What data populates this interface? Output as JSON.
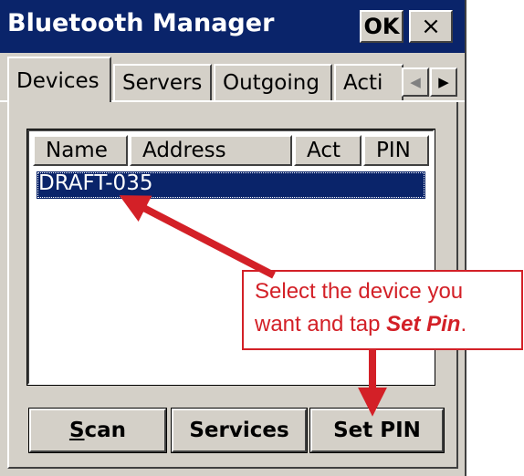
{
  "window": {
    "title": "Bluetooth Manager",
    "ok_label": "OK",
    "close_label": "×"
  },
  "tabs": [
    {
      "label": "Devices",
      "active": true
    },
    {
      "label": "Servers",
      "active": false
    },
    {
      "label": "Outgoing",
      "active": false
    },
    {
      "label": "Acti",
      "active": false
    }
  ],
  "tab_scroll": {
    "left_icon": "◀",
    "right_icon": "▶"
  },
  "list": {
    "columns": [
      "Name",
      "Address",
      "Act",
      "PIN"
    ],
    "rows": [
      {
        "name": "DRAFT-035",
        "selected": true
      }
    ]
  },
  "buttons": {
    "scan_first": "S",
    "scan_rest": "can",
    "services": "Services",
    "set_pin": "Set PIN"
  },
  "callout": {
    "line1": "Select the device you",
    "line2_prefix": "want and tap ",
    "line2_emphasis": "Set Pin",
    "line2_suffix": "."
  },
  "colors": {
    "titlebar": "#0a246a",
    "face": "#d4d0c8",
    "annotation": "#d32027"
  }
}
